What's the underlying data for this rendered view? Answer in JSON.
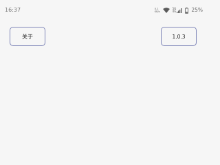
{
  "status_bar": {
    "time": "16:37",
    "speed_value": "0.1",
    "speed_unit": "KB/s",
    "network_signal_label": "5G",
    "network_type_label": "4G",
    "battery_percent": "25%",
    "icons": [
      "speed-indicator",
      "wifi-icon",
      "cellular-signal-icon",
      "battery-icon"
    ]
  },
  "main": {
    "about_button_label": "关于",
    "version_label": "1.0.3"
  },
  "colors": {
    "background": "#f6f6f6",
    "button_border": "#7f86b8",
    "text": "#222222",
    "status_text": "#7a7a7a"
  }
}
